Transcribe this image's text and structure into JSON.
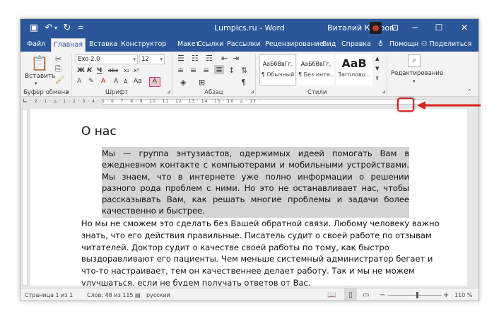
{
  "window": {
    "title": "Lumpics.ru - Word",
    "user_name": "Виталий Каиров",
    "controls": {
      "minimize": "─",
      "restore": "❐",
      "maximize": "☐",
      "close": "✕"
    }
  },
  "tabs": [
    "Файл",
    "Главная",
    "Вставка",
    "Конструктор",
    "Макет",
    "Ссылки",
    "Рассылки",
    "Рецензирование",
    "Вид",
    "Справка"
  ],
  "tab_extra": {
    "help_label": "Помощн",
    "share_label": "Поделиться"
  },
  "ribbon": {
    "clipboard": {
      "paste": "Вставить",
      "label": "Буфер обмена"
    },
    "font": {
      "name": "Exo 2.0",
      "size": "12",
      "bold": "Ж",
      "italic": "К",
      "underline": "Ч",
      "strike": "abc",
      "label": "Шрифт"
    },
    "paragraph": {
      "label": "Абзац"
    },
    "styles": {
      "items": [
        {
          "sample": "АаБбВвГг,",
          "name": "¶ Обычный"
        },
        {
          "sample": "АаБбВвГг,",
          "name": "¶ Без инте..."
        },
        {
          "sample": "АаВ",
          "name": "Заголово..."
        }
      ],
      "label": "Стили"
    },
    "editing": {
      "label": "Редактирование"
    }
  },
  "ruler": {
    "numbers": "· 2 · 1 · ⌂ · 1 · 2 · 3 · 4 · 5 · 6 · 7 · 8 · 9 · 10 · 11 · 12 · 13 · 14 · 15 · 16 · ⌂ · 17 ·"
  },
  "document": {
    "heading": "О нас",
    "para1": "Мы — группа энтузиастов, одержимых идеей помогать Вам в ежедневном контакте с компьютерами и мобильными устройствами. Мы знаем, что в интернете уже полно информации о решении разного рода проблем с ними. Но это не останавливает нас, чтобы рассказывать Вам, как решать многие проблемы и задачи более качественно и быстрее.",
    "para2": "Но мы не сможем это сделать без Вашей обратной связи. Любому человеку важно знать, что его действия правильные. Писатель судит о своей работе по отзывам читателей. Доктор судит о качестве своей работы по тому, как быстро выздоравливают его пациенты. Чем меньше системный администратор бегает и что-то настраивает, тем он качественнее делает работу. Так и мы не можем улучшаться, если не будем получать ответов от Вас."
  },
  "status": {
    "page": "Страница 1 из 1",
    "words": "Слов: 48 из 115",
    "language": "русский",
    "zoom": "110 %"
  },
  "colors": {
    "accent": "#2b579a",
    "annotation": "#d9211f"
  }
}
